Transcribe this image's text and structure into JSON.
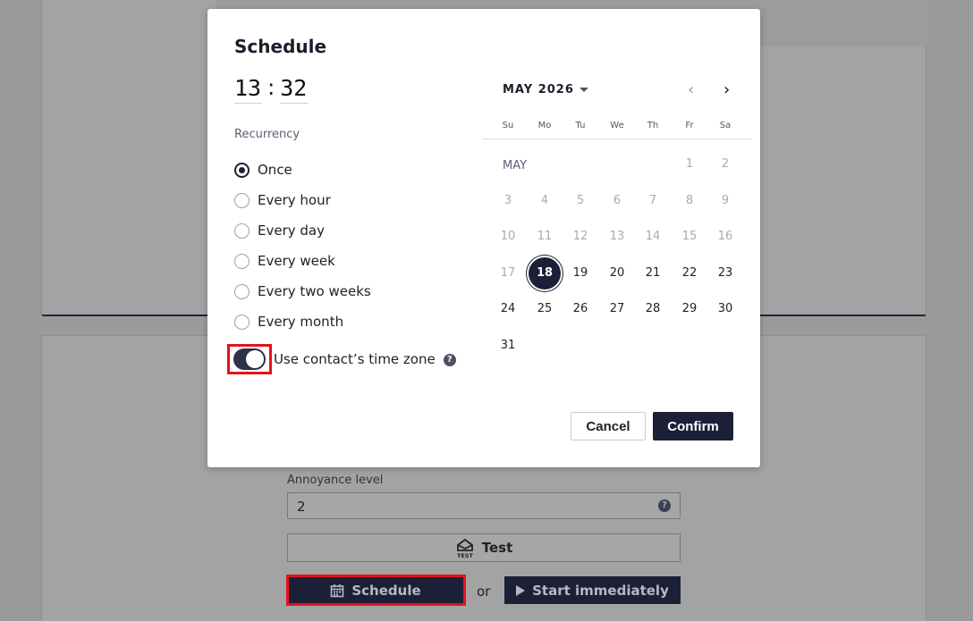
{
  "background": {
    "annoyance_label": "Annoyance level",
    "annoyance_value": "2",
    "test_label": "Test",
    "schedule_label": "Schedule",
    "or_label": "or",
    "start_label": "Start immediately"
  },
  "modal": {
    "title": "Schedule",
    "time": {
      "hour": "13",
      "separator": ":",
      "minute": "32"
    },
    "recurrency_label": "Recurrency",
    "recurrency_options": [
      {
        "label": "Once",
        "selected": true
      },
      {
        "label": "Every hour",
        "selected": false
      },
      {
        "label": "Every day",
        "selected": false
      },
      {
        "label": "Every week",
        "selected": false
      },
      {
        "label": "Every two weeks",
        "selected": false
      },
      {
        "label": "Every month",
        "selected": false
      }
    ],
    "timezone_toggle": {
      "label": "Use contact’s time zone",
      "on": true
    },
    "calendar": {
      "header": "MAY 2026",
      "month_label": "MAY",
      "weekdays": [
        "Su",
        "Mo",
        "Tu",
        "We",
        "Th",
        "Fr",
        "Sa"
      ],
      "first_weekday_index": 5,
      "days_in_month": 31,
      "selected_day": 18
    },
    "cancel_label": "Cancel",
    "confirm_label": "Confirm"
  },
  "colors": {
    "primary": "#1c2037",
    "highlight": "#e8111b"
  }
}
